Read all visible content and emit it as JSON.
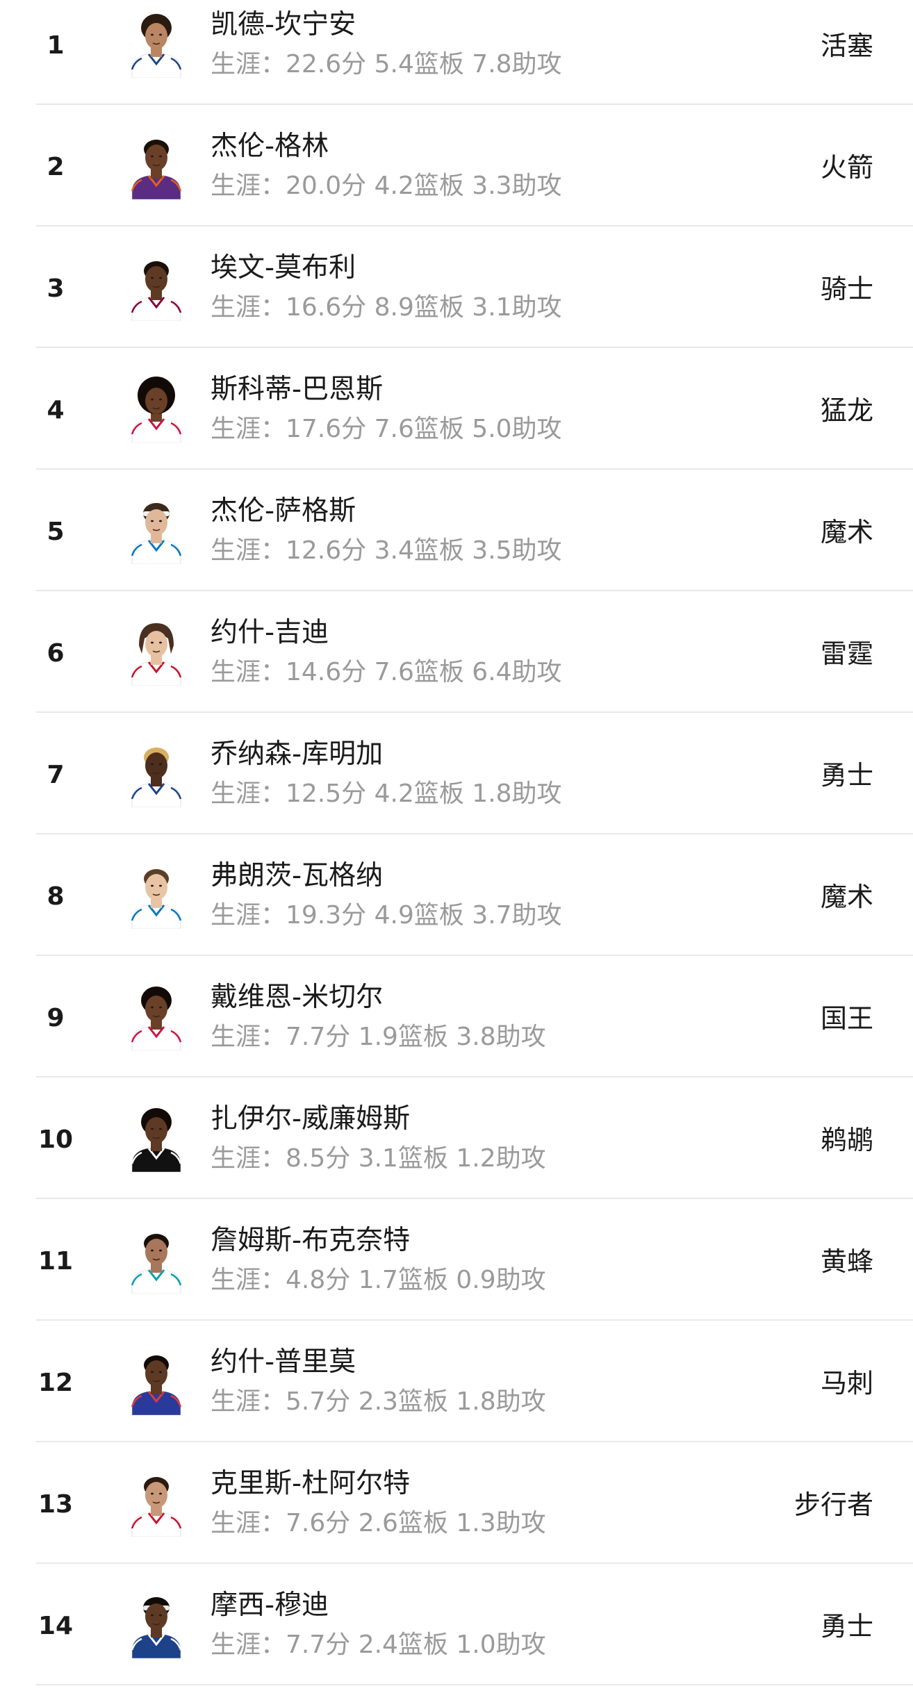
{
  "players": [
    {
      "rank": "1",
      "name": "凯德-坎宁安",
      "stats": "生涯：22.6分 5.4篮板 7.8助攻",
      "team": "活塞",
      "jersey": "#ffffff",
      "trim": "#1d428a",
      "skin": "#b98563",
      "hair": "#2a1a10",
      "hair_style": "curly"
    },
    {
      "rank": "2",
      "name": "杰伦-格林",
      "stats": "生涯：20.0分 4.2篮板 3.3助攻",
      "team": "火箭",
      "jersey": "#5a2c82",
      "trim": "#e56020",
      "skin": "#6b4028",
      "hair": "#1a1008",
      "hair_style": "short"
    },
    {
      "rank": "3",
      "name": "埃文-莫布利",
      "stats": "生涯：16.6分 8.9篮板 3.1助攻",
      "team": "骑士",
      "jersey": "#ffffff",
      "trim": "#860038",
      "skin": "#5e3a24",
      "hair": "#1a1008",
      "hair_style": "short"
    },
    {
      "rank": "4",
      "name": "斯科蒂-巴恩斯",
      "stats": "生涯：17.6分 7.6篮板 5.0助攻",
      "team": "猛龙",
      "jersey": "#ffffff",
      "trim": "#ce1141",
      "skin": "#6b4028",
      "hair": "#120a06",
      "hair_style": "afro"
    },
    {
      "rank": "5",
      "name": "杰伦-萨格斯",
      "stats": "生涯：12.6分 3.4篮板 3.5助攻",
      "team": "魔术",
      "jersey": "#ffffff",
      "trim": "#0077c0",
      "skin": "#e0b899",
      "hair": "#3a2a1c",
      "hair_style": "headband"
    },
    {
      "rank": "6",
      "name": "约什-吉迪",
      "stats": "生涯：14.6分 7.6篮板 6.4助攻",
      "team": "雷霆",
      "jersey": "#ffffff",
      "trim": "#c8102e",
      "skin": "#e6c0a0",
      "hair": "#4a3020",
      "hair_style": "long"
    },
    {
      "rank": "7",
      "name": "乔纳森-库明加",
      "stats": "生涯：12.5分 4.2篮板 1.8助攻",
      "team": "勇士",
      "jersey": "#ffffff",
      "trim": "#1d428a",
      "skin": "#4e2e1c",
      "hair": "#d8b060",
      "hair_style": "short"
    },
    {
      "rank": "8",
      "name": "弗朗茨-瓦格纳",
      "stats": "生涯：19.3分 4.9篮板 3.7助攻",
      "team": "魔术",
      "jersey": "#ffffff",
      "trim": "#0077c0",
      "skin": "#e8c4a4",
      "hair": "#5a3e28",
      "hair_style": "short"
    },
    {
      "rank": "9",
      "name": "戴维恩-米切尔",
      "stats": "生涯：7.7分 1.9篮板 3.8助攻",
      "team": "国王",
      "jersey": "#ffffff",
      "trim": "#ce1141",
      "skin": "#6b4028",
      "hair": "#120a06",
      "hair_style": "curly"
    },
    {
      "rank": "10",
      "name": "扎伊尔-威廉姆斯",
      "stats": "生涯：8.5分 3.1篮板 1.2助攻",
      "team": "鹈鹕",
      "jersey": "#111111",
      "trim": "#ffffff",
      "skin": "#5e3a24",
      "hair": "#120a06",
      "hair_style": "curly"
    },
    {
      "rank": "11",
      "name": "詹姆斯-布克奈特",
      "stats": "生涯：4.8分 1.7篮板 0.9助攻",
      "team": "黄蜂",
      "jersey": "#ffffff",
      "trim": "#00a0b0",
      "skin": "#a8765a",
      "hair": "#1a1008",
      "hair_style": "short"
    },
    {
      "rank": "12",
      "name": "约什-普里莫",
      "stats": "生涯：5.7分 2.3篮板 1.8助攻",
      "team": "马刺",
      "jersey": "#2a3a9a",
      "trim": "#e03a3e",
      "skin": "#5e3a24",
      "hair": "#120a06",
      "hair_style": "short"
    },
    {
      "rank": "13",
      "name": "克里斯-杜阿尔特",
      "stats": "生涯：7.6分 2.6篮板 1.3助攻",
      "team": "步行者",
      "jersey": "#ffffff",
      "trim": "#c8102e",
      "skin": "#c89878",
      "hair": "#2a1a10",
      "hair_style": "short"
    },
    {
      "rank": "14",
      "name": "摩西-穆迪",
      "stats": "生涯：7.7分 2.4篮板 1.0助攻",
      "team": "勇士",
      "jersey": "#1d428a",
      "trim": "#ffffff",
      "skin": "#5e3a24",
      "hair": "#120a06",
      "hair_style": "headband"
    }
  ]
}
